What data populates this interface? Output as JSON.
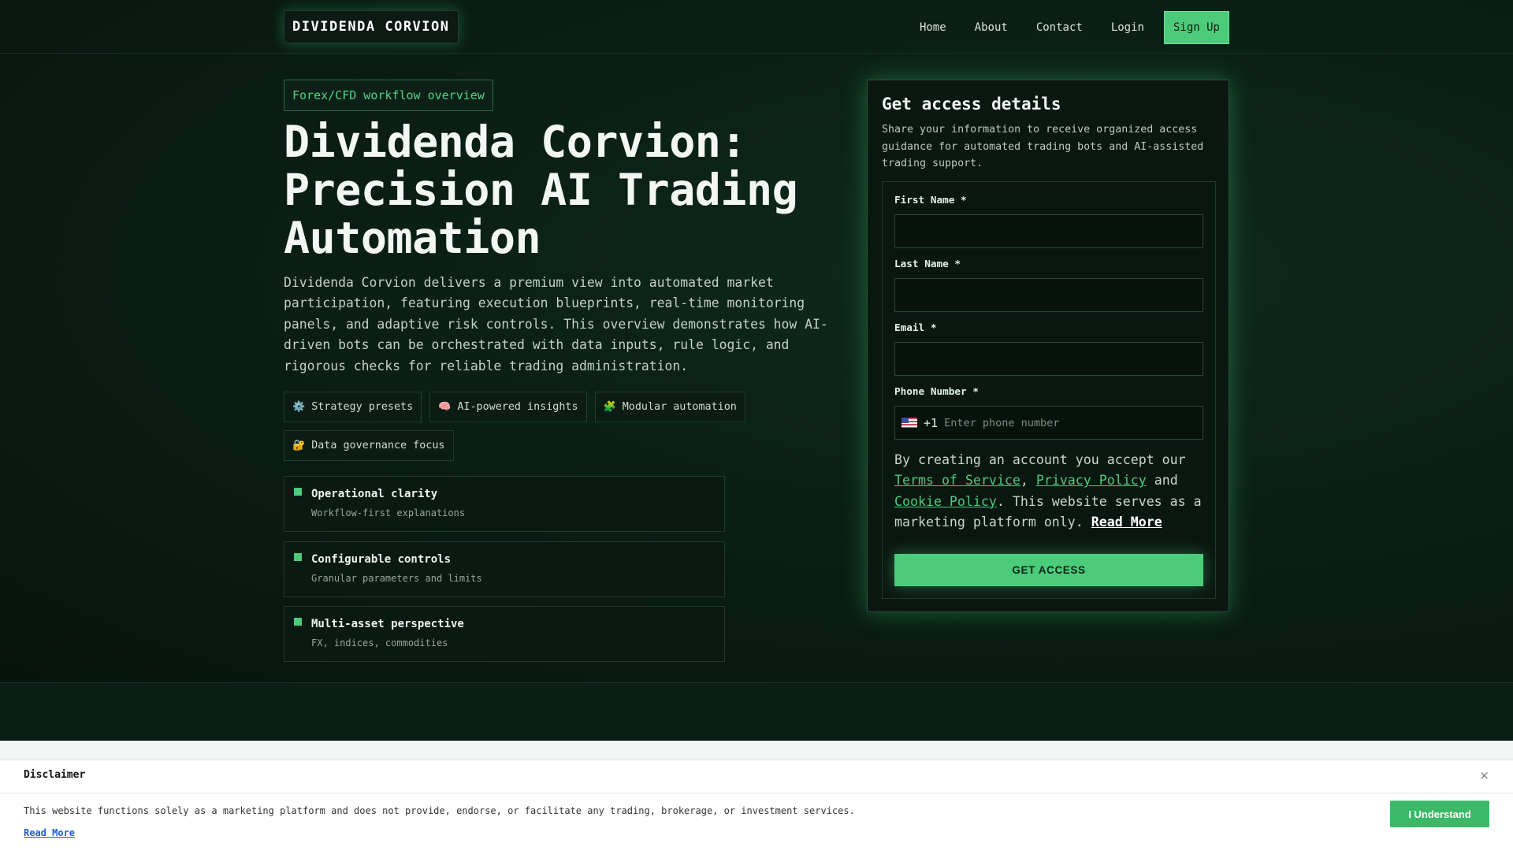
{
  "header": {
    "logo": "DIVIDENDA CORVION",
    "nav": [
      "Home",
      "About",
      "Contact",
      "Login"
    ],
    "signup": "Sign Up"
  },
  "hero": {
    "pill": "Forex/CFD workflow overview",
    "title_line1": "Dividenda Corvion:",
    "title_line2": "Precision AI Trading",
    "title_line3": "Automation",
    "lead": "Dividenda Corvion delivers a premium view into automated market participation, featuring execution blueprints, real-time monitoring panels, and adaptive risk controls. This overview demonstrates how AI-driven bots can be orchestrated with data inputs, rule logic, and rigorous checks for reliable trading administration.",
    "tags": [
      {
        "icon": "⚙️",
        "icon_name": "gear-icon",
        "label": "Strategy presets"
      },
      {
        "icon": "🧠",
        "icon_name": "brain-icon",
        "label": "AI-powered insights"
      },
      {
        "icon": "🧩",
        "icon_name": "puzzle-icon",
        "label": "Modular automation"
      },
      {
        "icon": "🔐",
        "icon_name": "lock-icon",
        "label": "Data governance focus"
      }
    ],
    "features": [
      {
        "title": "Operational clarity",
        "sub": "Workflow-first explanations"
      },
      {
        "title": "Configurable controls",
        "sub": "Granular parameters and limits"
      },
      {
        "title": "Multi-asset perspective",
        "sub": "FX, indices, commodities"
      }
    ]
  },
  "form": {
    "title": "Get access details",
    "subtitle": "Share your information to receive organized access guidance for automated trading bots and AI-assisted trading support.",
    "first_name_label": "First Name *",
    "last_name_label": "Last Name *",
    "email_label": "Email *",
    "phone_label": "Phone Number *",
    "phone_code": "+1",
    "phone_placeholder": "Enter phone number",
    "terms_prefix": "By creating an account you accept our",
    "terms_link": "Terms of Service",
    "privacy_link": "Privacy Policy",
    "and": "and",
    "cookie_link": "Cookie Policy",
    "terms_suffix": ". This website serves as a marketing platform only.",
    "read_more": "Read More",
    "submit": "GET ACCESS"
  },
  "disclaimer": {
    "title": "Disclaimer",
    "close": "×",
    "text": "This website functions solely as a marketing platform and does not provide, endorse, or facilitate any trading, brokerage, or investment services.",
    "read_more": "Read More",
    "button": "I Understand"
  },
  "colors": {
    "accent": "#4ccb7a",
    "background": "#07130e"
  }
}
